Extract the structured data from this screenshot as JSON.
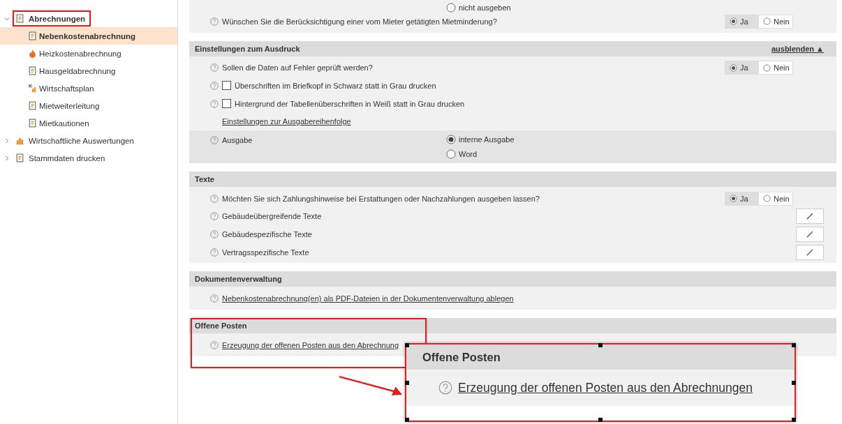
{
  "sidebar": {
    "items": [
      {
        "label": "Abrechnungen",
        "expanded": true,
        "selected": false,
        "highlighted": true,
        "children": [
          {
            "label": "Nebenkostenabrechnung",
            "selected": true
          },
          {
            "label": "Heizkostenabrechnung",
            "selected": false
          },
          {
            "label": "Hausgeldabrechnung",
            "selected": false
          },
          {
            "label": "Wirtschaftsplan",
            "selected": false
          },
          {
            "label": "Mietweiterleitung",
            "selected": false
          },
          {
            "label": "Mietkautionen",
            "selected": false
          }
        ]
      },
      {
        "label": "Wirtschaftliche Auswertungen",
        "expanded": false,
        "selected": false,
        "highlighted": false
      },
      {
        "label": "Stammdaten drucken",
        "expanded": false,
        "selected": false,
        "highlighted": false
      }
    ]
  },
  "sections": [
    {
      "highlighted": false,
      "rows": [
        {
          "kind": "choice",
          "shaded": false,
          "options": [
            {
              "label": "nicht ausgeben",
              "selected": false
            }
          ]
        },
        {
          "kind": "yes_no",
          "text": "Wünschen Sie die Berücksichtigung einer vom Mieter getätigten Mietminderung?",
          "options": [
            {
              "label": "Ja",
              "selected": true
            },
            {
              "label": "Nein",
              "selected": false
            }
          ]
        }
      ]
    },
    {
      "title": "Einstellungen zum Ausdruck",
      "toggle": "ausblenden ▲",
      "highlighted": false,
      "rows": [
        {
          "kind": "yes_no",
          "text": "Sollen die Daten auf Fehler geprüft werden?",
          "options": [
            {
              "label": "Ja",
              "selected": true
            },
            {
              "label": "Nein",
              "selected": false
            }
          ]
        },
        {
          "kind": "checkbox",
          "text": "Überschriften im Briefkopf in Schwarz statt in Grau drucken",
          "checked": false
        },
        {
          "kind": "checkbox",
          "text": "Hintergrund der Tabellenüberschriften in Weiß statt in Grau drucken",
          "checked": false
        },
        {
          "kind": "link",
          "text": "Einstellungen zur Ausgabereihenfolge"
        },
        {
          "kind": "choice",
          "shaded": true,
          "text": "Ausgabe",
          "options": [
            {
              "label": "interne Ausgabe",
              "selected": true
            },
            {
              "label": "Word",
              "selected": false
            }
          ]
        }
      ]
    },
    {
      "title": "Texte",
      "highlighted": false,
      "rows": [
        {
          "kind": "yes_no",
          "text": "Möchten Sie sich Zahlungshinweise bei Erstattungen oder Nachzahlungen ausgeben lassen?",
          "options": [
            {
              "label": "Ja",
              "selected": true
            },
            {
              "label": "Nein",
              "selected": false
            }
          ]
        },
        {
          "kind": "edit",
          "text": "Gebäudeübergreifende Texte"
        },
        {
          "kind": "edit",
          "text": "Gebäudespezifische Texte"
        },
        {
          "kind": "edit",
          "text": "Vertragsspezifische Texte"
        }
      ]
    },
    {
      "title": "Dokumentenverwaltung",
      "highlighted": false,
      "rows": [
        {
          "kind": "help_link",
          "text": "Nebenkostenabrechnung(en) als PDF-Dateien in der Dokumentenverwaltung ablegen"
        }
      ]
    },
    {
      "title": "Offene Posten",
      "highlighted": true,
      "rows": [
        {
          "kind": "help_link",
          "text": "Erzeugung der offenen Posten aus den Abrechnung"
        }
      ]
    }
  ],
  "callout": {
    "title": "Offene Posten",
    "link": "Erzeugung der offenen Posten aus den Abrechnungen"
  }
}
